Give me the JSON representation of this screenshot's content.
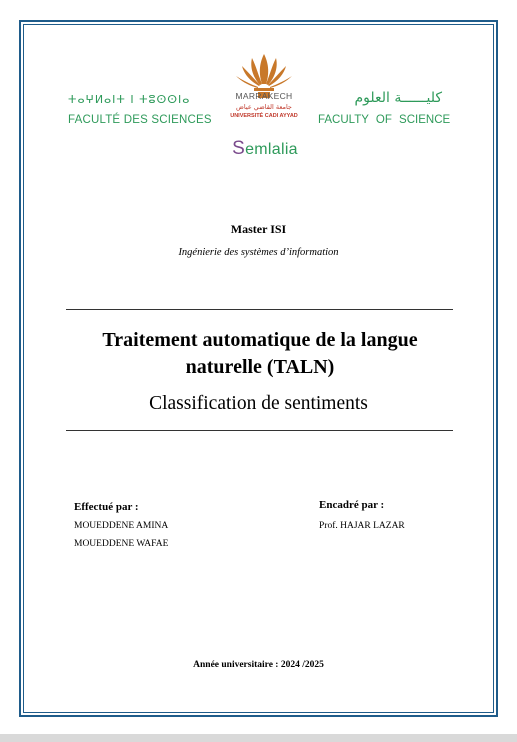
{
  "header": {
    "tifinagh_name": "ⵜⴰⵖⵍⴰⵏⵜ ⵏ ⵜⵓⵙⵙⵏⴰ",
    "faculty_fr": "FACULTÉ DES SCIENCES",
    "faculty_ar": "كليــــــة العلوم",
    "faculty_en": "FACULTY  OF  SCIENCE",
    "city": "MARRAKECH",
    "university_ar": "جامعة القاضي عياض",
    "university_fr": "UNIVERSITÉ CADI AYYAD",
    "campus_first": "S",
    "campus_rest": "emlalia"
  },
  "program": {
    "master": "Master ISI",
    "subtitle": "Ingénierie des systèmes d’information"
  },
  "document": {
    "title": "Traitement automatique de la langue naturelle (TALN)",
    "topic": "Classification de sentiments"
  },
  "authors": {
    "label": "Effectué par :",
    "names": [
      "MOUEDDENE AMINA",
      "MOUEDDENE WAFAE"
    ]
  },
  "supervisor": {
    "label": "Encadré par :",
    "name": "Prof. HAJAR LAZAR"
  },
  "footer": {
    "academic_year": "Année universitaire : 2024 /2025"
  },
  "colors": {
    "frame": "#1f5c8a",
    "faculty_green": "#2e9a5a",
    "logo_orange": "#c8782a",
    "university_red": "#c0392b",
    "semlalia_purple": "#7a4a8c"
  }
}
